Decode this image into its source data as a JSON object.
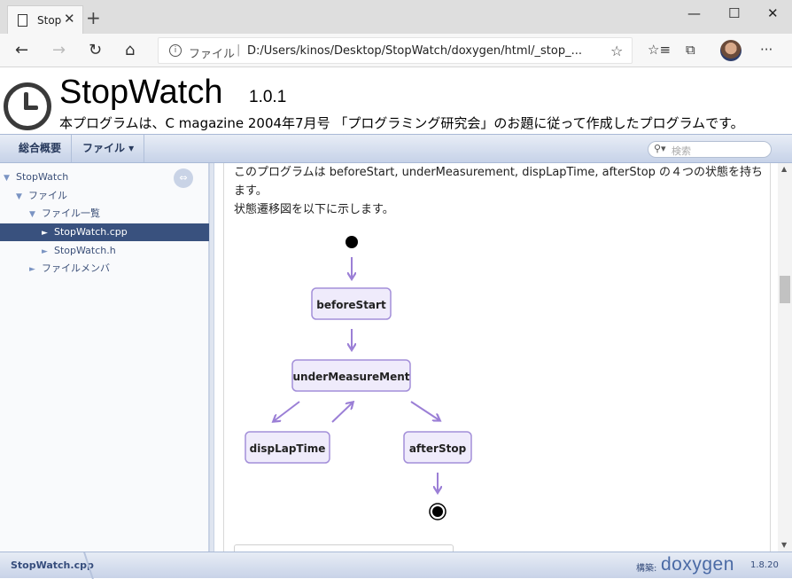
{
  "browser": {
    "tab_title": "Stop",
    "tab_close": "✕",
    "new_tab": "+",
    "window_controls": {
      "minimize": "—",
      "maximize": "☐",
      "close": "✕"
    },
    "site_label": "ファイル",
    "url": "D:/Users/kinos/Desktop/StopWatch/doxygen/html/_stop_...",
    "icons": [
      "back-icon",
      "forward-icon",
      "refresh-icon",
      "home-icon",
      "info-icon",
      "favorite-star-icon",
      "favorites-icon",
      "collections-icon",
      "profile-avatar",
      "more-icon"
    ]
  },
  "header": {
    "project_name": "StopWatch",
    "project_number": "1.0.1",
    "project_brief": "本プログラムは、C magazine 2004年7月号 「プログラミング研究会」のお題に従って作成したプログラムです。"
  },
  "menubar": {
    "items": [
      "総合概要",
      "ファイル ▾"
    ],
    "search_placeholder": "検索"
  },
  "nav_tree": [
    {
      "label": "StopWatch",
      "arrow": "▼",
      "level": 0,
      "selected": false
    },
    {
      "label": "ファイル",
      "arrow": "▼",
      "level": 1,
      "selected": false
    },
    {
      "label": "ファイル一覧",
      "arrow": "▼",
      "level": 2,
      "selected": false
    },
    {
      "label": "StopWatch.cpp",
      "arrow": "►",
      "level": 3,
      "selected": true
    },
    {
      "label": "StopWatch.h",
      "arrow": "►",
      "level": 3,
      "selected": false
    },
    {
      "label": "ファイルメンバ",
      "arrow": "►",
      "level": 2,
      "selected": false
    }
  ],
  "content": {
    "line1": "このプログラムは beforeStart, underMeasurement, dispLapTime, afterStop の４つの状態を持ち",
    "line2": "ます。",
    "line3": "状態遷移図を以下に示します。"
  },
  "diagram": {
    "states": [
      "beforeStart",
      "underMeasureMent",
      "dispLapTime",
      "afterStop"
    ],
    "colors": {
      "state_fill": "#efebfb",
      "state_border": "#a38fd9",
      "arrow": "#9b7fd6"
    }
  },
  "footer": {
    "file": "StopWatch.cpp",
    "generated_by": "構築:",
    "doxygen": "doxygen",
    "version": "1.8.20"
  }
}
